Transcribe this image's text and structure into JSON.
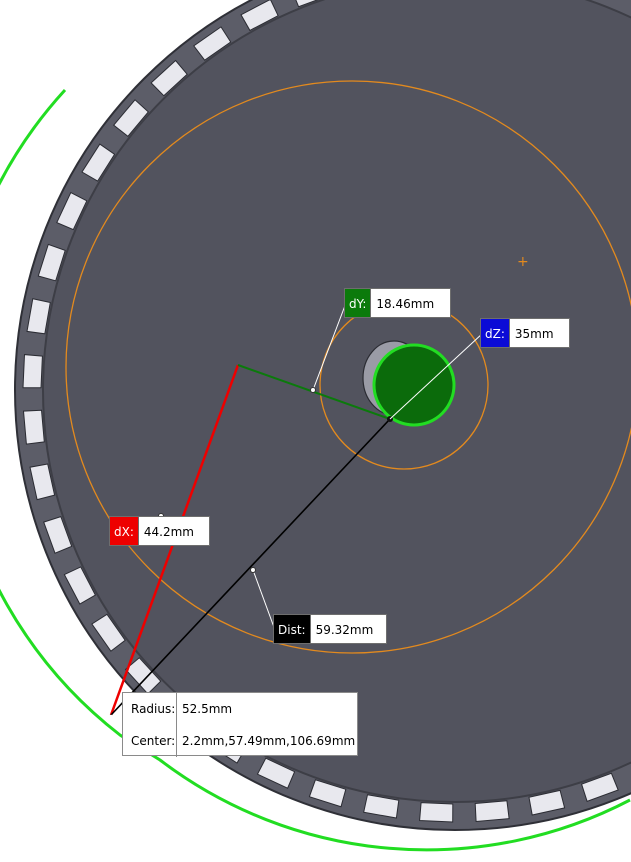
{
  "colors": {
    "part_face": "#52535e",
    "part_edge": "#3d3e46",
    "selected_edge": "#22dd22",
    "orange_circle": "#e38a1e",
    "dx_color": "#ee0000",
    "dy_color": "#0b7a0b",
    "dz_color": "#0b0bd6",
    "dist_color": "#000000"
  },
  "measurements": {
    "dy": {
      "label": "dY:",
      "value": "18.46mm"
    },
    "dz": {
      "label": "dZ:",
      "value": "35mm"
    },
    "dx": {
      "label": "dX:",
      "value": "44.2mm"
    },
    "dist": {
      "label": "Dist:",
      "value": "59.32mm"
    }
  },
  "selection_info": {
    "radius_label": "Radius:",
    "radius_value": "52.5mm",
    "center_label": "Center:",
    "center_value": "2.2mm,57.49mm,106.69mm"
  },
  "origin_marker": "+"
}
